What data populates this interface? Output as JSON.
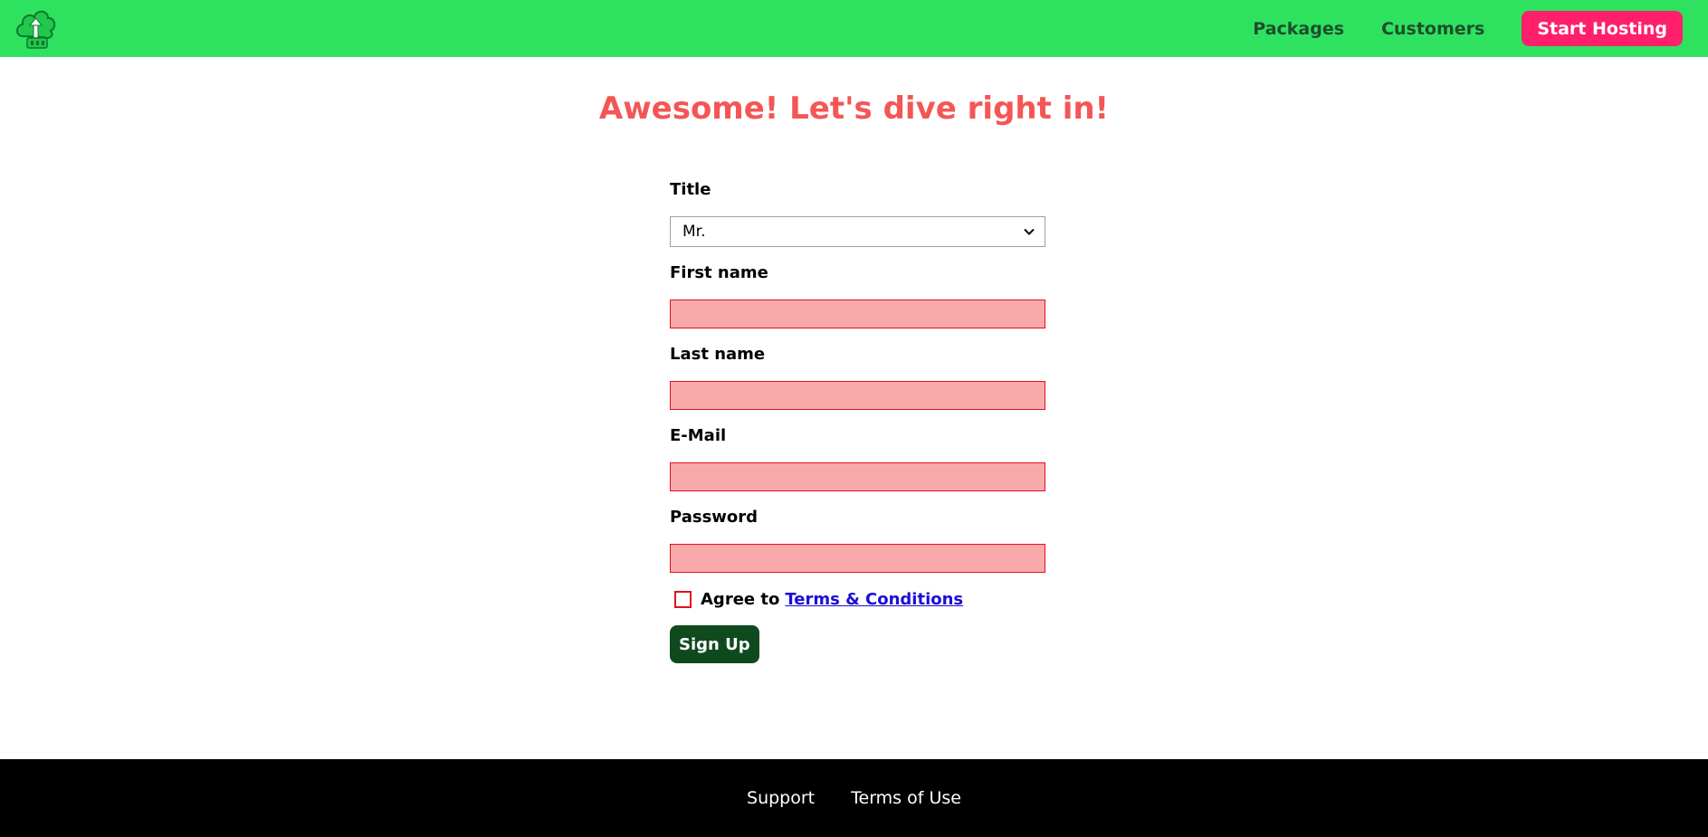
{
  "nav": {
    "links": [
      {
        "label": "Packages"
      },
      {
        "label": "Customers"
      }
    ],
    "cta_label": "Start Hosting"
  },
  "headline": "Awesome! Let's dive right in!",
  "form": {
    "title_label": "Title",
    "title_value": "Mr.",
    "first_name_label": "First name",
    "last_name_label": "Last name",
    "email_label": "E-Mail",
    "password_label": "Password",
    "agree_text": "Agree to",
    "terms_link": "Terms & Conditions",
    "submit_label": "Sign Up"
  },
  "footer": {
    "links": [
      {
        "label": "Support"
      },
      {
        "label": "Terms of Use"
      }
    ]
  },
  "colors": {
    "navbar": "#2ee260",
    "cta": "#ff1f6b",
    "headline": "#f45656",
    "invalid_input_bg": "#f9a9aa",
    "invalid_input_border": "#e3101c",
    "submit": "#0f4a1e",
    "link": "#1a0ed6",
    "footer": "#000000"
  },
  "icons": {
    "logo": "cloud-logo-icon",
    "select_arrow": "chevron-down-icon"
  }
}
